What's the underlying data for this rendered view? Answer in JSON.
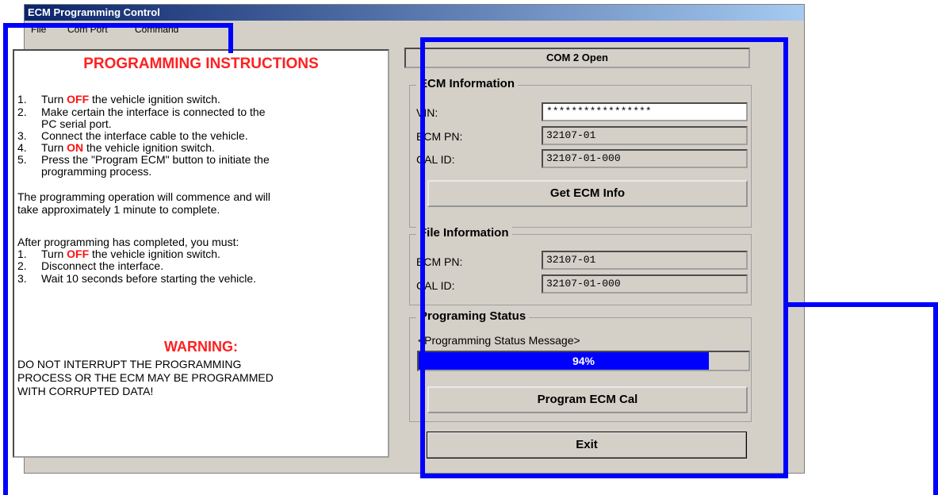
{
  "window": {
    "title": "ECM Programming Control"
  },
  "menu": [
    "File",
    "Com Port",
    "Command"
  ],
  "instructions": {
    "heading": "PROGRAMMING INSTRUCTIONS",
    "steps": [
      {
        "num": "1.",
        "pre": "Turn ",
        "emph": "OFF",
        "post": " the vehicle ignition switch."
      },
      {
        "num": "2.",
        "text": "Make certain the interface is connected to the"
      },
      {
        "num": "",
        "text": "PC serial port."
      },
      {
        "num": "3.",
        "text": "Connect the interface cable to the vehicle."
      },
      {
        "num": "4.",
        "pre": "Turn ",
        "emph": "ON",
        "post": " the vehicle ignition switch."
      },
      {
        "num": "5.",
        "text": "Press the \"Program ECM\" button to initiate the"
      },
      {
        "num": "",
        "text": "programming process."
      }
    ],
    "note_lines": [
      "The programming operation will commence and will",
      "take approximately 1 minute to complete."
    ],
    "after_heading": "After programming has completed, you must:",
    "after_steps": [
      {
        "num": "1.",
        "pre": "Turn ",
        "emph": "OFF",
        "post": " the vehicle ignition switch."
      },
      {
        "num": "2.",
        "text": "Disconnect the interface."
      },
      {
        "num": "3.",
        "text": "Wait 10 seconds before starting the vehicle."
      }
    ],
    "warning_heading": "WARNING:",
    "warning_lines": [
      "DO NOT INTERRUPT THE PROGRAMMING",
      "PROCESS OR THE ECM MAY BE PROGRAMMED",
      "WITH CORRUPTED DATA!"
    ]
  },
  "com_status": "COM 2 Open",
  "ecm_info": {
    "title": "ECM Information",
    "vin_label": "VIN:",
    "vin_value": "*****************",
    "pn_label": "ECM PN:",
    "pn_value": "32107-01",
    "cal_label": "CAL ID:",
    "cal_value": "32107-01-000",
    "button": "Get ECM Info"
  },
  "file_info": {
    "title": "File Information",
    "pn_label": "ECM PN:",
    "pn_value": "32107-01",
    "cal_label": "CAL ID:",
    "cal_value": "32107-01-000"
  },
  "status": {
    "title": "Programing Status",
    "message": "<Programming Status Message>",
    "progress_text": "94%",
    "progress_fraction": 0.88,
    "program_button": "Program ECM Cal"
  },
  "exit_button": "Exit",
  "colors": {
    "highlight": "#0000ff",
    "progress": "#0000ff",
    "warning": "#ff1010",
    "face": "#d4d0c8"
  }
}
